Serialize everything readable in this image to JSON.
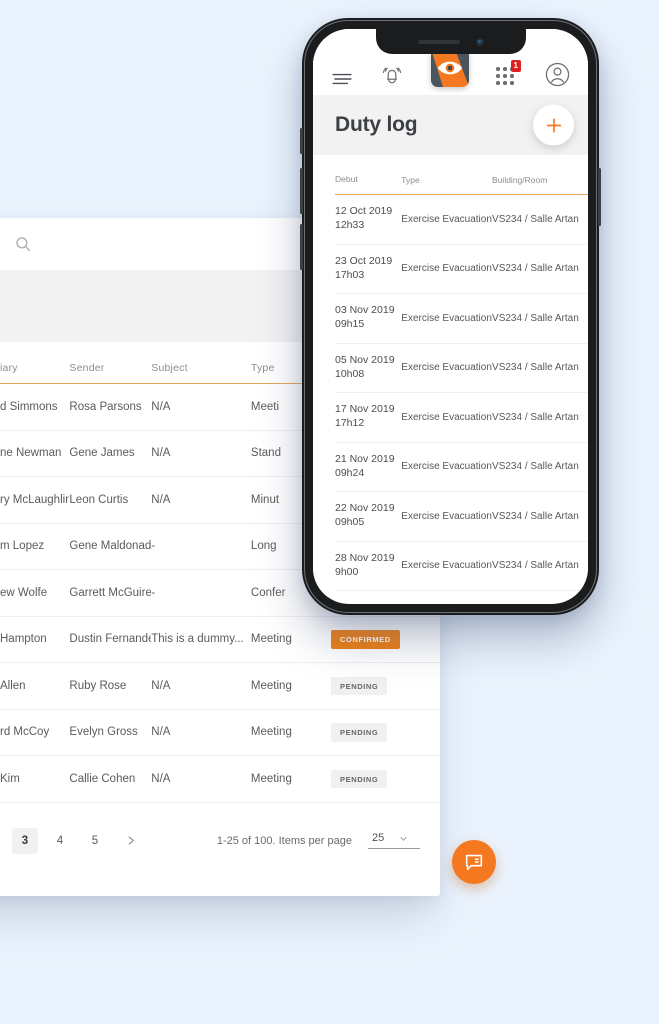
{
  "theme": {
    "page_background": "#eaf3fd",
    "accent_orange": "#f4781f",
    "badge_red": "#e02020",
    "header_rule": "#e8a45c"
  },
  "desktop": {
    "search": {
      "icon": "search-icon",
      "placeholder": "",
      "value": ""
    },
    "table": {
      "columns": [
        "iary",
        "Sender",
        "Subject",
        "Type",
        ""
      ],
      "rows": [
        {
          "beneficiary": "d Simmons",
          "sender": "Rosa Parsons",
          "subject": "N/A",
          "type": "Meeti",
          "status": ""
        },
        {
          "beneficiary": "ne Newman",
          "sender": "Gene James",
          "subject": "N/A",
          "type": "Stand",
          "status": ""
        },
        {
          "beneficiary": "ry McLaughlin",
          "sender": "Leon Curtis",
          "subject": "N/A",
          "type": "Minut",
          "status": ""
        },
        {
          "beneficiary": "m Lopez",
          "sender": "Gene Maldonado",
          "subject": "-",
          "type": "Long",
          "status": ""
        },
        {
          "beneficiary": "ew Wolfe",
          "sender": "Garrett McGuire",
          "subject": "-",
          "type": "Confer",
          "status": ""
        },
        {
          "beneficiary": "Hampton",
          "sender": "Dustin Fernandez",
          "subject": "This is a dummy...",
          "type": "Meeting",
          "status": "CONFIRMED"
        },
        {
          "beneficiary": "Allen",
          "sender": "Ruby Rose",
          "subject": "N/A",
          "type": "Meeting",
          "status": "PENDING"
        },
        {
          "beneficiary": "rd McCoy",
          "sender": "Evelyn Gross",
          "subject": "N/A",
          "type": "Meeting",
          "status": "PENDING"
        },
        {
          "beneficiary": "Kim",
          "sender": "Callie Cohen",
          "subject": "N/A",
          "type": "Meeting",
          "status": "PENDING"
        }
      ]
    },
    "pagination": {
      "pages": [
        "3",
        "4",
        "5"
      ],
      "active_page": "3",
      "next_icon": "chevron-right-icon",
      "info": "1-25 of 100. Items per page",
      "items_per_page": "25",
      "dropdown_icon": "chevron-down-icon"
    },
    "chat_fab": {
      "icon": "chat-bubble-icon",
      "label": ""
    }
  },
  "phone": {
    "nav": {
      "menu": {
        "icon": "hamburger-menu-icon"
      },
      "alerts": {
        "icon": "bell-ringing-icon"
      },
      "logo": {
        "icon": "shield-eye-logo-icon"
      },
      "apps": {
        "icon": "grid-dots-icon",
        "badge": "1"
      },
      "account": {
        "icon": "user-avatar-icon"
      }
    },
    "header": {
      "title": "Duty log",
      "add_button": {
        "icon": "plus-icon",
        "label": ""
      }
    },
    "table": {
      "columns": [
        "Debut",
        "Type",
        "Building/Room"
      ],
      "rows": [
        {
          "date": "12 Oct 2019",
          "time": "12h33",
          "type": "Exercise Evacuation",
          "room": "VS234 / Salle Artan"
        },
        {
          "date": "23 Oct 2019",
          "time": "17h03",
          "type": "Exercise Evacuation",
          "room": "VS234 / Salle Artan"
        },
        {
          "date": "03 Nov 2019",
          "time": "09h15",
          "type": "Exercise Evacuation",
          "room": "VS234 / Salle Artan"
        },
        {
          "date": "05 Nov 2019",
          "time": "10h08",
          "type": "Exercise Evacuation",
          "room": "VS234 / Salle Artan"
        },
        {
          "date": "17 Nov 2019",
          "time": "17h12",
          "type": "Exercise Evacuation",
          "room": "VS234 / Salle Artan"
        },
        {
          "date": "21 Nov 2019",
          "time": "09h24",
          "type": "Exercise Evacuation",
          "room": "VS234 / Salle Artan"
        },
        {
          "date": "22 Nov 2019",
          "time": "09h05",
          "type": "Exercise Evacuation",
          "room": "VS234 / Salle Artan"
        },
        {
          "date": "28 Nov 2019",
          "time": "9h00",
          "type": "Exercise Evacuation",
          "room": "VS234 / Salle Artan"
        }
      ]
    }
  }
}
